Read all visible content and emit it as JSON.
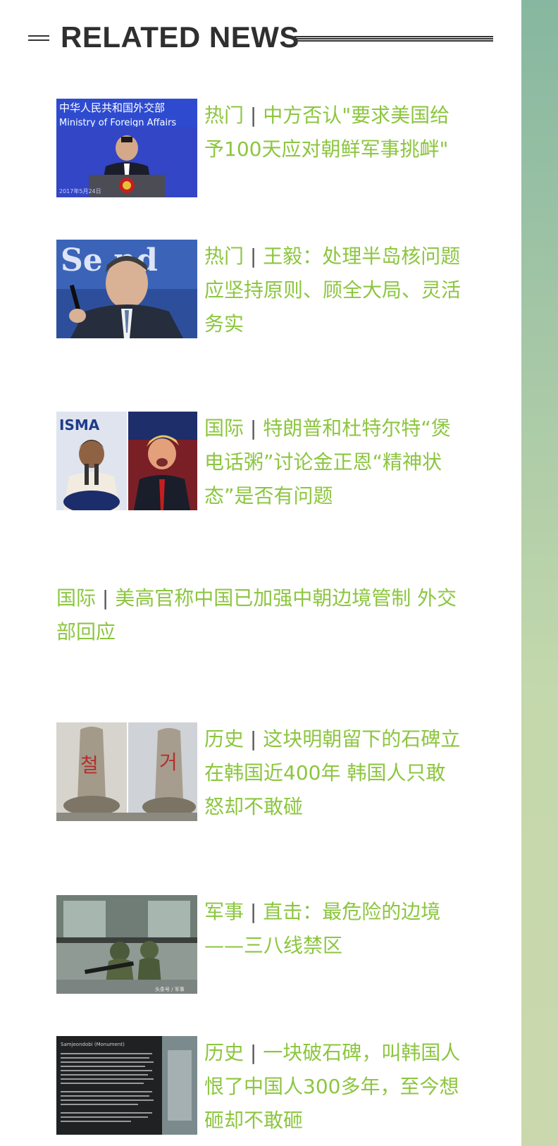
{
  "header": {
    "title": "RELATED NEWS"
  },
  "news": [
    {
      "category": "热门",
      "separator": "|",
      "title": "中方否认\"要求美国给予100天应对朝鲜军事挑衅\"",
      "image": "spokesperson-podium-photo"
    },
    {
      "category": "热门",
      "separator": "|",
      "title": "王毅：处理半岛核问题应坚持原则、顾全大局、灵活务实",
      "image": "official-portrait-photo"
    },
    {
      "category": "国际",
      "separator": "|",
      "title": "特朗普和杜特尔特“煲电话粥”讨论金正恩“精神状态”是否有问题",
      "image": "two-leaders-photo"
    },
    {
      "category": "国际",
      "separator": "|",
      "title": "美高官称中国已加强中朝边境管制 外交部回应",
      "image": null
    },
    {
      "category": "历史",
      "separator": "|",
      "title": "这块明朝留下的石碑立在韩国近400年 韩国人只敢怒却不敢碰",
      "image": "stone-tablets-photo"
    },
    {
      "category": "军事",
      "separator": "|",
      "title": "直击：最危险的边境——三八线禁区",
      "image": "soldiers-photo"
    },
    {
      "category": "历史",
      "separator": "|",
      "title": "一块破石碑，叫韩国人恨了中国人300多年，至今想砸却不敢砸",
      "image": "monument-plaque-photo"
    }
  ]
}
